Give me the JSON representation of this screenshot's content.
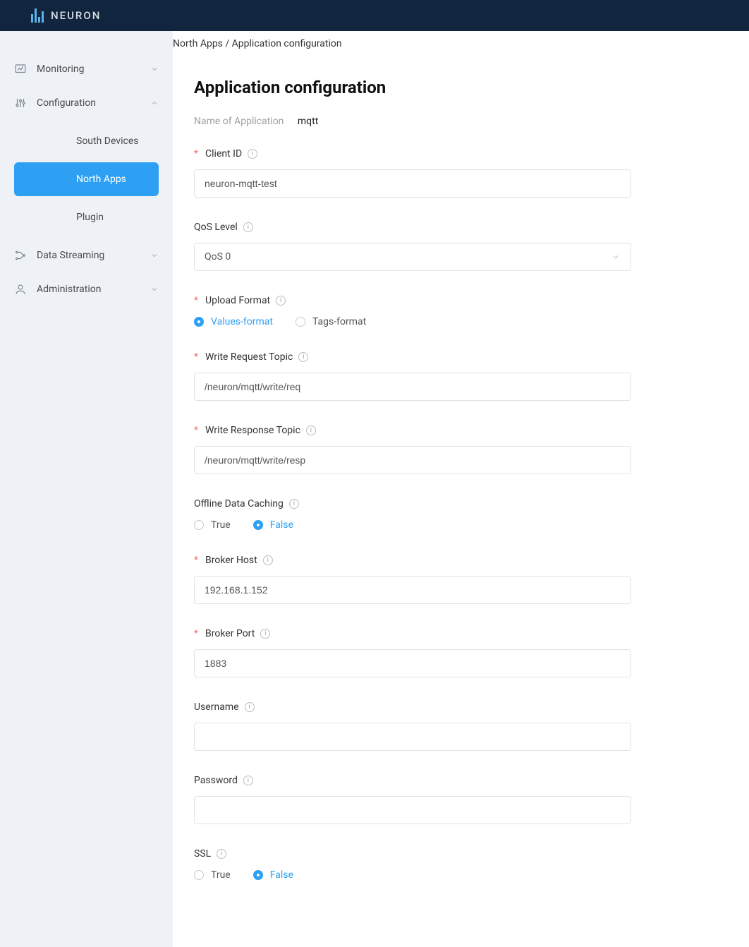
{
  "brand": {
    "name": "NEURON"
  },
  "breadcrumb": {
    "root": "North Apps",
    "current": "Application configuration"
  },
  "sidebar": {
    "groups": [
      {
        "label": "Monitoring",
        "expanded": false
      },
      {
        "label": "Configuration",
        "expanded": true,
        "items": [
          {
            "label": "South Devices",
            "active": false
          },
          {
            "label": "North Apps",
            "active": true
          },
          {
            "label": "Plugin",
            "active": false
          }
        ]
      },
      {
        "label": "Data Streaming",
        "expanded": false
      },
      {
        "label": "Administration",
        "expanded": false
      }
    ]
  },
  "page": {
    "title": "Application configuration",
    "app_name_label": "Name of Application",
    "app_name_value": "mqtt",
    "fields": {
      "client_id": {
        "label": "Client ID",
        "value": "neuron-mqtt-test",
        "required": true
      },
      "qos": {
        "label": "QoS Level",
        "value": "QoS 0",
        "required": false
      },
      "upload_format": {
        "label": "Upload Format",
        "required": true,
        "options": [
          {
            "label": "Values-format",
            "selected": true
          },
          {
            "label": "Tags-format",
            "selected": false
          }
        ]
      },
      "write_req": {
        "label": "Write Request Topic",
        "value": "/neuron/mqtt/write/req",
        "required": true
      },
      "write_resp": {
        "label": "Write Response Topic",
        "value": "/neuron/mqtt/write/resp",
        "required": true
      },
      "offline_cache": {
        "label": "Offline Data Caching",
        "required": false,
        "options": [
          {
            "label": "True",
            "selected": false
          },
          {
            "label": "False",
            "selected": true
          }
        ]
      },
      "broker_host": {
        "label": "Broker Host",
        "value": "192.168.1.152",
        "required": true
      },
      "broker_port": {
        "label": "Broker Port",
        "value": "1883",
        "required": true
      },
      "username": {
        "label": "Username",
        "value": "",
        "required": false
      },
      "password": {
        "label": "Password",
        "value": "",
        "required": false
      },
      "ssl": {
        "label": "SSL",
        "required": false,
        "options": [
          {
            "label": "True",
            "selected": false
          },
          {
            "label": "False",
            "selected": true
          }
        ]
      }
    }
  }
}
